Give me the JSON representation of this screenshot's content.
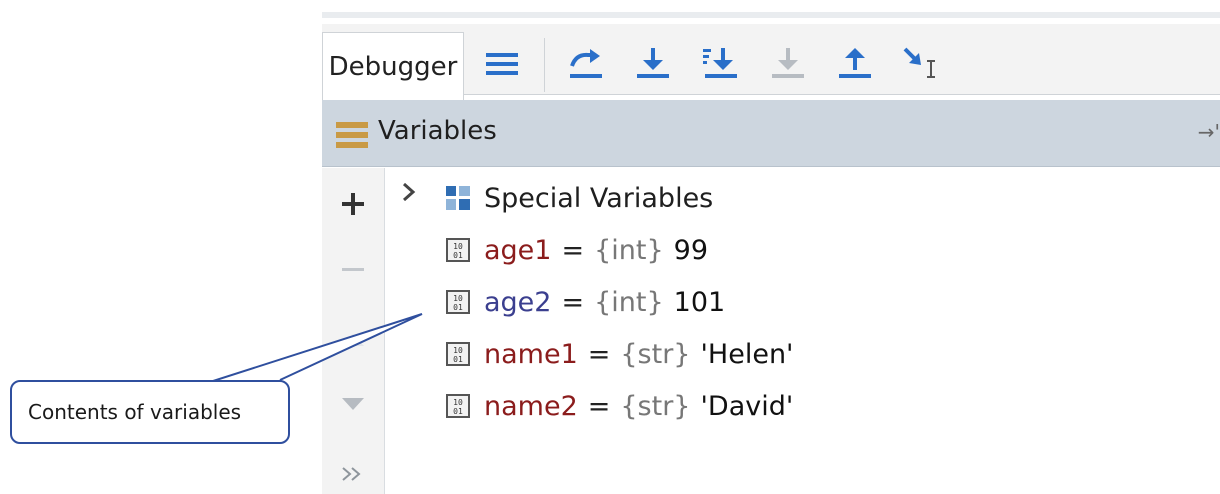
{
  "toolbar": {
    "tab_label": "Debugger",
    "buttons": [
      {
        "name": "show-execution-point-icon"
      },
      {
        "name": "step-over-icon"
      },
      {
        "name": "step-into-icon"
      },
      {
        "name": "step-into-my-code-icon"
      },
      {
        "name": "force-step-into-icon"
      },
      {
        "name": "step-out-icon"
      },
      {
        "name": "run-to-cursor-icon"
      }
    ]
  },
  "variables_panel": {
    "title": "Variables",
    "pin_glyph": "→'",
    "side_controls": [
      "+",
      "−",
      "▲",
      "▼",
      "»"
    ],
    "special": {
      "label": "Special Variables"
    },
    "items": [
      {
        "name": "age1",
        "eq": "=",
        "type": "{int}",
        "value": "99",
        "color": "#8b1c1c"
      },
      {
        "name": "age2",
        "eq": "=",
        "type": "{int}",
        "value": "101",
        "color": "#3b3f8f"
      },
      {
        "name": "name1",
        "eq": "=",
        "type": "{str}",
        "value": "'Helen'",
        "color": "#8b1c1c"
      },
      {
        "name": "name2",
        "eq": "=",
        "type": "{str}",
        "value": "'David'",
        "color": "#8b1c1c"
      }
    ]
  },
  "annotation": {
    "text": "Contents of variables"
  },
  "colors": {
    "accent_blue": "#2a6fc9",
    "header_bg": "#cdd6df",
    "menu_icon": "#c99a45"
  }
}
